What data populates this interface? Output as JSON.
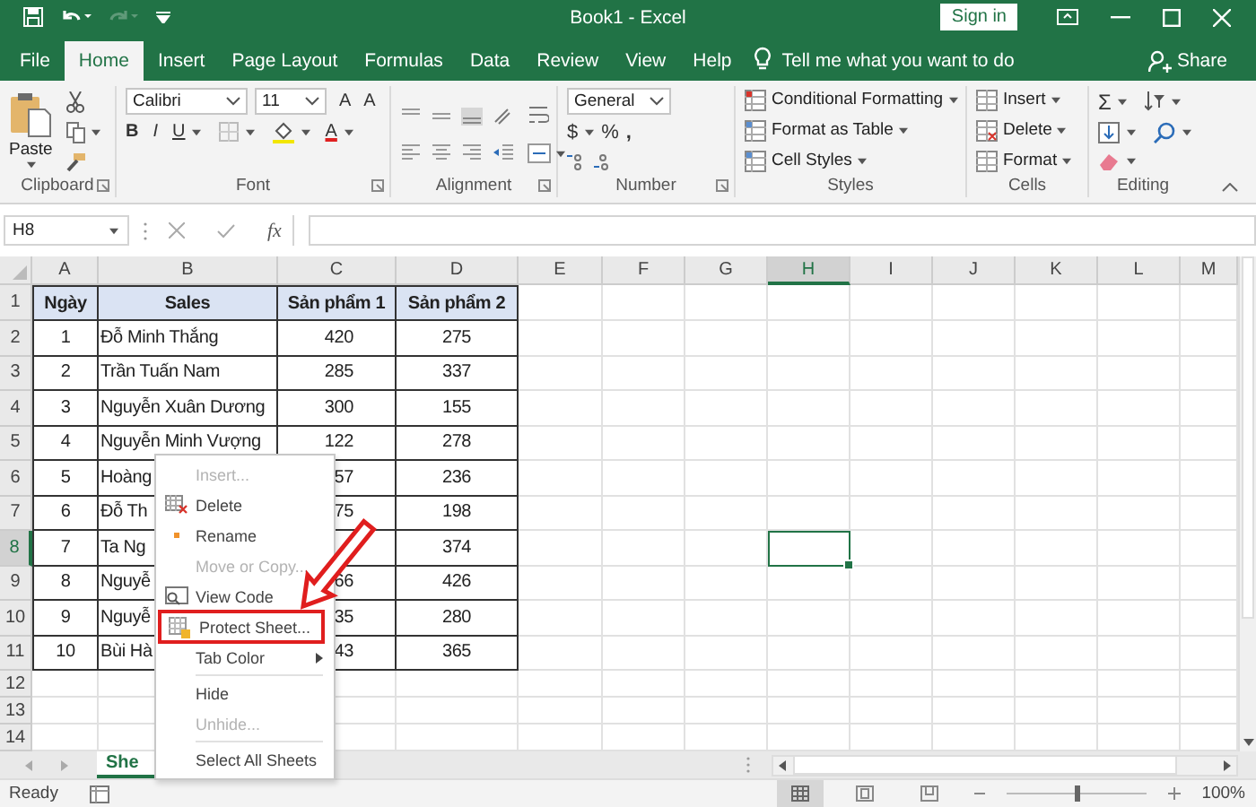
{
  "window": {
    "title": "Book1 - Excel",
    "sign_in": "Sign in"
  },
  "tabs": [
    {
      "label": "File",
      "selected": false
    },
    {
      "label": "Home",
      "selected": true
    },
    {
      "label": "Insert",
      "selected": false
    },
    {
      "label": "Page Layout",
      "selected": false
    },
    {
      "label": "Formulas",
      "selected": false
    },
    {
      "label": "Data",
      "selected": false
    },
    {
      "label": "Review",
      "selected": false
    },
    {
      "label": "View",
      "selected": false
    },
    {
      "label": "Help",
      "selected": false
    }
  ],
  "tell_me": {
    "placeholder": "Tell me what you want to do"
  },
  "share": "Share",
  "ribbon": {
    "clipboard": {
      "paste": "Paste",
      "label": "Clipboard"
    },
    "font": {
      "name": "Calibri",
      "size": "11",
      "grow": "A",
      "shrink": "A",
      "bold": "B",
      "italic": "I",
      "underline": "U",
      "font_color_letter": "A",
      "label": "Font"
    },
    "alignment": {
      "label": "Alignment"
    },
    "number": {
      "format": "General",
      "currency": "$",
      "percent": "%",
      "comma": ",",
      "label": "Number"
    },
    "styles": {
      "buttons": [
        "Conditional Formatting",
        "Format as Table",
        "Cell Styles"
      ],
      "label": "Styles"
    },
    "cells": {
      "buttons": [
        "Insert",
        "Delete",
        "Format"
      ],
      "label": "Cells"
    },
    "editing": {
      "sum": "Σ",
      "label": "Editing"
    }
  },
  "formula_bar": {
    "name_box": "H8",
    "function_label": "fx"
  },
  "columns": [
    {
      "label": "A",
      "selected": false
    },
    {
      "label": "B",
      "selected": false
    },
    {
      "label": "C",
      "selected": false
    },
    {
      "label": "D",
      "selected": false
    },
    {
      "label": "E",
      "selected": false
    },
    {
      "label": "F",
      "selected": false
    },
    {
      "label": "G",
      "selected": false
    },
    {
      "label": "H",
      "selected": true
    },
    {
      "label": "I",
      "selected": false
    },
    {
      "label": "J",
      "selected": false
    },
    {
      "label": "K",
      "selected": false
    },
    {
      "label": "L",
      "selected": false
    },
    {
      "label": "M",
      "selected": false
    }
  ],
  "row_headers": [
    {
      "label": "1",
      "selected": false
    },
    {
      "label": "2",
      "selected": false
    },
    {
      "label": "3",
      "selected": false
    },
    {
      "label": "4",
      "selected": false
    },
    {
      "label": "5",
      "selected": false
    },
    {
      "label": "6",
      "selected": false
    },
    {
      "label": "7",
      "selected": false
    },
    {
      "label": "8",
      "selected": true
    },
    {
      "label": "9",
      "selected": false
    },
    {
      "label": "10",
      "selected": false
    },
    {
      "label": "11",
      "selected": false
    },
    {
      "label": "12",
      "selected": false
    },
    {
      "label": "13",
      "selected": false
    },
    {
      "label": "14",
      "selected": false
    }
  ],
  "table": {
    "columns": [
      "Ngày",
      "Sales",
      "Sản phẩm 1",
      "Sản phẩm 2"
    ],
    "rows": [
      {
        "day": "1",
        "sales": "Đỗ Minh Thắng",
        "product_1": "420",
        "product_2": "275"
      },
      {
        "day": "2",
        "sales": "Trần Tuấn Nam",
        "product_1": "285",
        "product_2": "337"
      },
      {
        "day": "3",
        "sales": "Nguyễn Xuân Dương",
        "product_1": "300",
        "product_2": "155"
      },
      {
        "day": "4",
        "sales": "Nguyễn Minh Vượng",
        "product_1": "122",
        "product_2": "278"
      },
      {
        "day": "5",
        "sales": "Hoàng",
        "product_1": "57",
        "product_2": "236"
      },
      {
        "day": "6",
        "sales": "Đỗ Th",
        "product_1": "75",
        "product_2": "198"
      },
      {
        "day": "7",
        "sales": "Ta Ng",
        "product_2": "374"
      },
      {
        "day": "8",
        "sales": "Nguyễ",
        "product_1": "66",
        "product_2": "426"
      },
      {
        "day": "9",
        "sales": "Nguyễ",
        "product_1": "35",
        "product_2": "280"
      },
      {
        "day": "10",
        "sales": "Bùi Hà",
        "product_1": "43",
        "product_2": "365"
      }
    ]
  },
  "context_menu": [
    {
      "kind": "item",
      "label": "Insert...",
      "disabled": true,
      "boxed": false
    },
    {
      "kind": "item",
      "label": "Delete",
      "disabled": false,
      "boxed": false
    },
    {
      "kind": "item",
      "label": "Rename",
      "disabled": false,
      "boxed": false
    },
    {
      "kind": "item",
      "label": "Move or Copy...",
      "disabled": true,
      "boxed": false
    },
    {
      "kind": "item",
      "label": "View Code",
      "disabled": false,
      "boxed": false
    },
    {
      "kind": "item",
      "label": "Protect Sheet...",
      "disabled": false,
      "boxed": true
    },
    {
      "kind": "submenu",
      "label": "Tab Color",
      "disabled": false,
      "boxed": false
    },
    {
      "kind": "separator"
    },
    {
      "kind": "item",
      "label": "Hide",
      "disabled": false,
      "boxed": false
    },
    {
      "kind": "item",
      "label": "Unhide...",
      "disabled": true,
      "boxed": false
    },
    {
      "kind": "separator"
    },
    {
      "kind": "item",
      "label": "Select All Sheets",
      "disabled": false,
      "boxed": false
    }
  ],
  "sheet_tabs": [
    {
      "label": "She",
      "selected": true
    }
  ],
  "status_bar": {
    "status": "Ready",
    "zoom": "100%",
    "zoom_slider": {
      "level": 0.5
    }
  }
}
